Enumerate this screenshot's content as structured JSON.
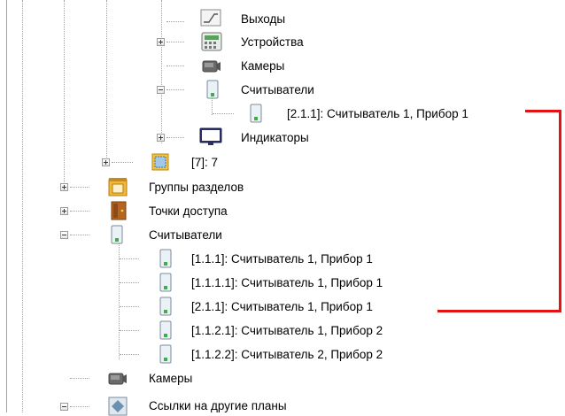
{
  "tree": {
    "outputs": "Выходы",
    "devices": "Устройства",
    "cameras_inner": "Камеры",
    "readers_inner": "Считыватели",
    "reader_inner_item": "[2.1.1]: Считыватель 1, Прибор 1",
    "indicators": "Индикаторы",
    "zone7": "[7]: 7",
    "partition_groups": "Группы разделов",
    "access_points": "Точки доступа",
    "readers": "Считыватели",
    "readers_items": [
      "[1.1.1]: Считыватель 1, Прибор 1",
      "[1.1.1.1]: Считыватель 1, Прибор 1",
      "[2.1.1]: Считыватель 1, Прибор 1",
      "[1.1.2.1]: Считыватель 1, Прибор 2",
      "[1.1.2.2]: Считыватель 2, Прибор 2"
    ],
    "cameras": "Камеры",
    "plan_links": "Ссылки на другие планы"
  },
  "colors": {
    "highlight_connector": "#e41212"
  }
}
